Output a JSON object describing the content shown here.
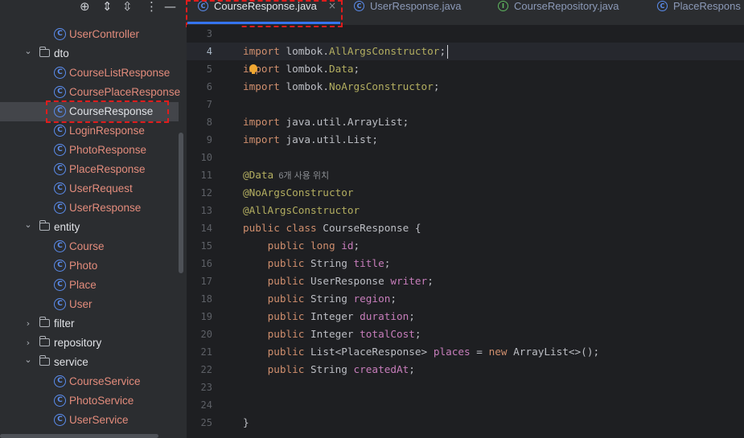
{
  "sidebar": {
    "toolbar_icons": [
      "crosshair-icon",
      "expand-collapse-icon",
      "collapse-all-icon",
      "more-options-icon",
      "hide-icon"
    ],
    "items": [
      {
        "kind": "class",
        "label": "UserController"
      },
      {
        "kind": "folder",
        "label": "dto",
        "expanded": true
      },
      {
        "kind": "class",
        "label": "CourseListResponse"
      },
      {
        "kind": "class",
        "label": "CoursePlaceResponse"
      },
      {
        "kind": "class",
        "label": "CourseResponse",
        "selected": true
      },
      {
        "kind": "class",
        "label": "LoginResponse"
      },
      {
        "kind": "class",
        "label": "PhotoResponse"
      },
      {
        "kind": "class",
        "label": "PlaceResponse"
      },
      {
        "kind": "class",
        "label": "UserRequest"
      },
      {
        "kind": "class",
        "label": "UserResponse"
      },
      {
        "kind": "folder",
        "label": "entity",
        "expanded": true
      },
      {
        "kind": "class",
        "label": "Course"
      },
      {
        "kind": "class",
        "label": "Photo"
      },
      {
        "kind": "class",
        "label": "Place"
      },
      {
        "kind": "class",
        "label": "User"
      },
      {
        "kind": "folder",
        "label": "filter",
        "expanded": false
      },
      {
        "kind": "folder",
        "label": "repository",
        "expanded": false
      },
      {
        "kind": "folder",
        "label": "service",
        "expanded": true
      },
      {
        "kind": "class",
        "label": "CourseService"
      },
      {
        "kind": "class",
        "label": "PhotoService"
      },
      {
        "kind": "class",
        "label": "UserService"
      }
    ]
  },
  "tabs": [
    {
      "label": "CourseResponse.java",
      "icon": "C",
      "active": true,
      "close": "×"
    },
    {
      "label": "UserResponse.java",
      "icon": "C",
      "active": false
    },
    {
      "label": "CourseRepository.java",
      "icon": "I",
      "active": false
    },
    {
      "label": "PlaceRespons",
      "icon": "C",
      "active": false
    }
  ],
  "editor": {
    "current_line": "4",
    "lines": [
      {
        "n": "3",
        "tokens": []
      },
      {
        "n": "4",
        "tokens": [
          {
            "t": "import",
            "c": "kw"
          },
          {
            "t": " lombok."
          },
          {
            "t": "AllArgsConstructor",
            "c": "an"
          },
          {
            "t": ";"
          }
        ]
      },
      {
        "n": "5",
        "tokens": [
          {
            "t": "import",
            "c": "kw"
          },
          {
            "t": " lombok."
          },
          {
            "t": "Data",
            "c": "an"
          },
          {
            "t": ";"
          }
        ]
      },
      {
        "n": "6",
        "tokens": [
          {
            "t": "import",
            "c": "kw"
          },
          {
            "t": " lombok."
          },
          {
            "t": "NoArgsConstructor",
            "c": "an"
          },
          {
            "t": ";"
          }
        ]
      },
      {
        "n": "7",
        "tokens": []
      },
      {
        "n": "8",
        "tokens": [
          {
            "t": "import",
            "c": "kw"
          },
          {
            "t": " java.util.ArrayList;"
          }
        ]
      },
      {
        "n": "9",
        "tokens": [
          {
            "t": "import",
            "c": "kw"
          },
          {
            "t": " java.util.List;"
          }
        ]
      },
      {
        "n": "10",
        "tokens": []
      },
      {
        "n": "11",
        "tokens": [
          {
            "t": "@Data",
            "c": "an"
          },
          {
            "t": "  6개 사용 위치",
            "c": "hint"
          }
        ]
      },
      {
        "n": "12",
        "tokens": [
          {
            "t": "@NoArgsConstructor",
            "c": "an"
          }
        ]
      },
      {
        "n": "13",
        "tokens": [
          {
            "t": "@AllArgsConstructor",
            "c": "an"
          }
        ]
      },
      {
        "n": "14",
        "tokens": [
          {
            "t": "public class",
            "c": "kw"
          },
          {
            "t": " CourseResponse {"
          }
        ]
      },
      {
        "n": "15",
        "tokens": [
          {
            "t": "    "
          },
          {
            "t": "public long",
            "c": "kw"
          },
          {
            "t": " "
          },
          {
            "t": "id",
            "c": "fld"
          },
          {
            "t": ";"
          }
        ]
      },
      {
        "n": "16",
        "tokens": [
          {
            "t": "    "
          },
          {
            "t": "public",
            "c": "kw"
          },
          {
            "t": " String "
          },
          {
            "t": "title",
            "c": "fld"
          },
          {
            "t": ";"
          }
        ]
      },
      {
        "n": "17",
        "tokens": [
          {
            "t": "    "
          },
          {
            "t": "public",
            "c": "kw"
          },
          {
            "t": " UserResponse "
          },
          {
            "t": "writer",
            "c": "fld"
          },
          {
            "t": ";"
          }
        ]
      },
      {
        "n": "18",
        "tokens": [
          {
            "t": "    "
          },
          {
            "t": "public",
            "c": "kw"
          },
          {
            "t": " String "
          },
          {
            "t": "region",
            "c": "fld"
          },
          {
            "t": ";"
          }
        ]
      },
      {
        "n": "19",
        "tokens": [
          {
            "t": "    "
          },
          {
            "t": "public",
            "c": "kw"
          },
          {
            "t": " Integer "
          },
          {
            "t": "duration",
            "c": "fld"
          },
          {
            "t": ";"
          }
        ]
      },
      {
        "n": "20",
        "tokens": [
          {
            "t": "    "
          },
          {
            "t": "public",
            "c": "kw"
          },
          {
            "t": " Integer "
          },
          {
            "t": "totalCost",
            "c": "fld"
          },
          {
            "t": ";"
          }
        ]
      },
      {
        "n": "21",
        "tokens": [
          {
            "t": "    "
          },
          {
            "t": "public",
            "c": "kw"
          },
          {
            "t": " List<PlaceResponse> "
          },
          {
            "t": "places",
            "c": "fld"
          },
          {
            "t": " = "
          },
          {
            "t": "new",
            "c": "kw"
          },
          {
            "t": " ArrayList<>();"
          }
        ]
      },
      {
        "n": "22",
        "tokens": [
          {
            "t": "    "
          },
          {
            "t": "public",
            "c": "kw"
          },
          {
            "t": " String "
          },
          {
            "t": "createdAt",
            "c": "fld"
          },
          {
            "t": ";"
          }
        ]
      },
      {
        "n": "23",
        "tokens": []
      },
      {
        "n": "24",
        "tokens": []
      },
      {
        "n": "25",
        "tokens": [
          {
            "t": "}"
          }
        ]
      }
    ]
  },
  "colors": {
    "keyword": "#cf8e6d",
    "annotation": "#b3ae60",
    "field": "#c77dbb",
    "class_file": "#e38c7c",
    "highlight_box": "#e01c1c",
    "active_tab_underline": "#3574f0"
  }
}
